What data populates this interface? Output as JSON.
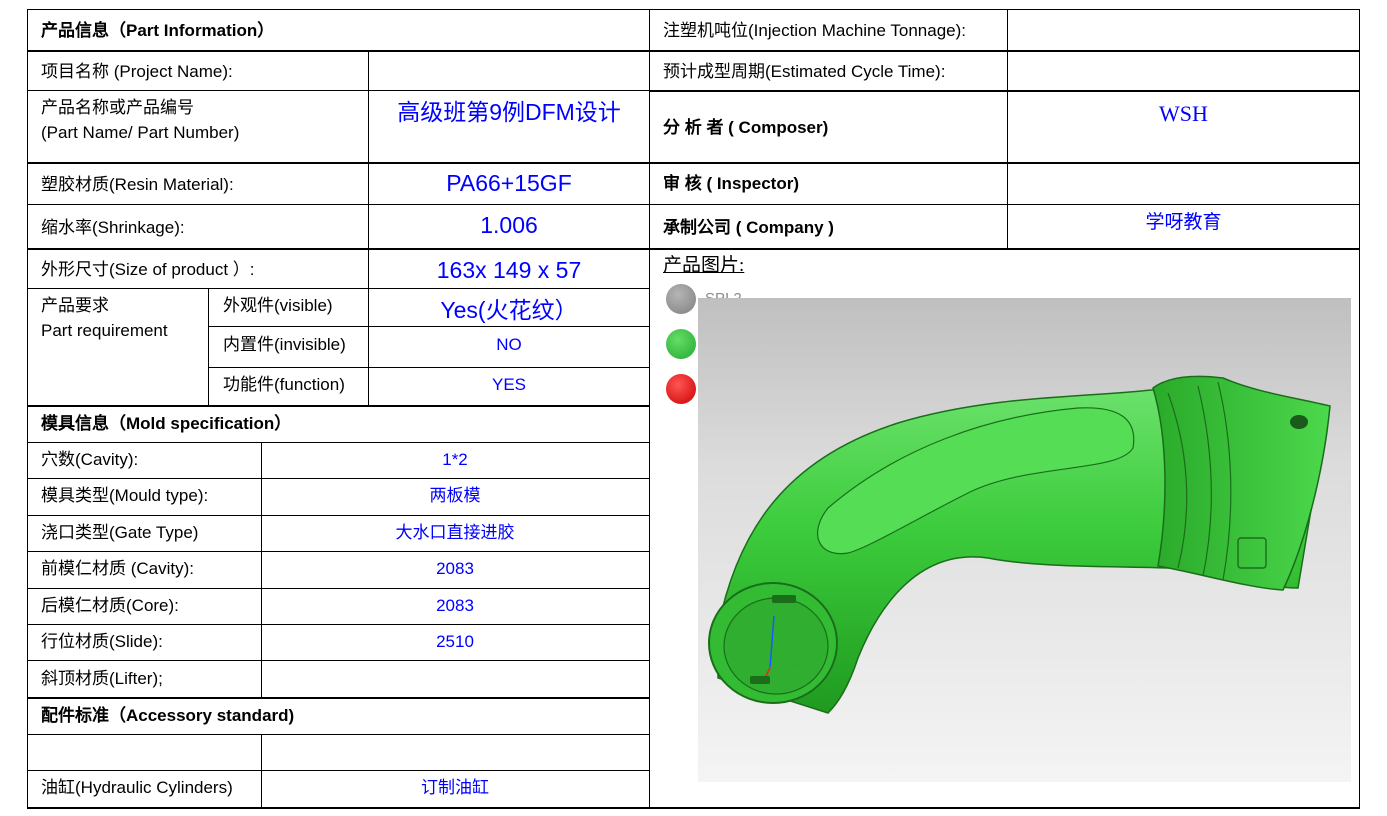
{
  "left_table": {
    "part_info_header": "产品信息（Part Information）",
    "project_name_label": "项目名称 (Project Name):",
    "project_name_value": "",
    "part_name_label_1": "产品名称或产品编号",
    "part_name_label_2": "(Part  Name/ Part  Number)",
    "part_name_value": "高级班第9例DFM设计",
    "resin_label": "塑胶材质(Resin Material):",
    "resin_value": "PA66+15GF",
    "shrinkage_label": "缩水率(Shrinkage):",
    "shrinkage_value": "1.006",
    "size_label": "外形尺寸(Size of product ）:",
    "size_value": "163x 149 x 57",
    "requirement_label_1": "产品要求",
    "requirement_label_2": "Part  requirement",
    "visible_label": "外观件(visible)",
    "visible_value": "Yes(火花纹）",
    "invisible_label": "内置件(invisible)",
    "invisible_value": "NO",
    "function_label": "功能件(function)",
    "function_value": "YES",
    "mold_header": "模具信息（Mold specification）",
    "cavity_label": "穴数(Cavity):",
    "cavity_value": "1*2",
    "mould_type_label": "模具类型(Mould type):",
    "mould_type_value": "两板模",
    "gate_type_label": "浇口类型(Gate Type)",
    "gate_type_value": "大水口直接进胶",
    "cavity_steel_label": "前模仁材质 (Cavity):",
    "cavity_steel_value": "2083",
    "core_steel_label": "后模仁材质(Core):",
    "core_steel_value": "2083",
    "slide_label": "行位材质(Slide):",
    "slide_value": "2510",
    "lifter_label": "斜顶材质(Lifter);",
    "lifter_value": "",
    "accessory_header": "配件标准（Accessory standard)",
    "hydraulic_label": "油缸(Hydraulic Cylinders)",
    "hydraulic_value": "订制油缸"
  },
  "right_table": {
    "tonnage_label": "注塑机吨位(Injection Machine Tonnage):",
    "tonnage_value": "",
    "cycle_label": "预计成型周期(Estimated Cycle Time):",
    "cycle_value": "",
    "composer_label": "分  析  者  ( Composer)",
    "composer_value": "WSH",
    "inspector_label": "审      核    ( Inspector)",
    "inspector_value": "",
    "company_label": "承制公司 ( Company )",
    "company_value": "学呀教育",
    "product_image_label": "产品图片:",
    "legend_partial": "SPI 2"
  },
  "colors": {
    "value_text": "#0000ff",
    "part_green": "#33cc33",
    "legend_gray": "#8c8c8c",
    "legend_green": "#33bb44",
    "legend_red": "#dd0000"
  }
}
